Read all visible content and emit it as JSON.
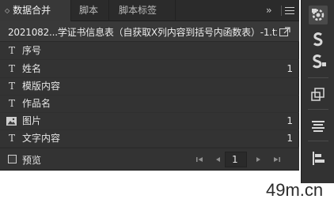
{
  "tabs": [
    {
      "label": "数据合并",
      "active": true
    },
    {
      "label": "脚本",
      "active": false
    },
    {
      "label": "脚本标签",
      "active": false
    }
  ],
  "tab_overflow": "››",
  "data_source": {
    "name": "2021082...学证书信息表（自获取X列内容到括号内函数表）-1.txt"
  },
  "fields": [
    {
      "type": "text",
      "type_glyph": "T",
      "label": "序号",
      "count": ""
    },
    {
      "type": "text",
      "type_glyph": "T",
      "label": "姓名",
      "count": "1"
    },
    {
      "type": "text",
      "type_glyph": "T",
      "label": "模版内容",
      "count": ""
    },
    {
      "type": "text",
      "type_glyph": "T",
      "label": "作品名",
      "count": ""
    },
    {
      "type": "image",
      "type_glyph": "",
      "label": "图片",
      "count": "1"
    },
    {
      "type": "text",
      "type_glyph": "T",
      "label": "文字内容",
      "count": "1"
    }
  ],
  "footer": {
    "preview_label": "预览",
    "preview_checked": false,
    "page": "1"
  },
  "toolbar_icons": [
    "data-merge-icon",
    "script-icon",
    "script-label-icon",
    "transform-icon",
    "paragraph-icon",
    "align-icon"
  ],
  "watermark": "49m.cn",
  "colors": {
    "panel_bg": "#333333",
    "tab_active_bg": "#383838",
    "text": "#e6e6e6"
  }
}
